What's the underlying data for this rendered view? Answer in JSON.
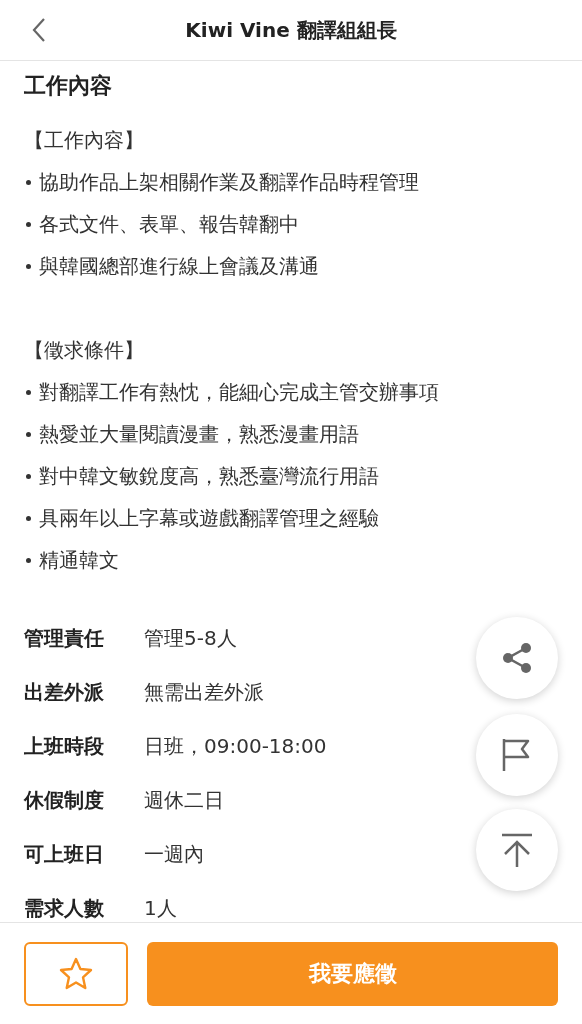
{
  "header": {
    "title": "Kiwi Vine 翻譯組組長"
  },
  "section_title": "工作內容",
  "groups": [
    {
      "heading": "【工作內容】",
      "items": [
        "協助作品上架相關作業及翻譯作品時程管理",
        "各式文件、表單、報告韓翻中",
        "與韓國總部進行線上會議及溝通"
      ]
    },
    {
      "heading": "【徵求條件】",
      "items": [
        "對翻譯工作有熱忱，能細心完成主管交辦事項",
        "熱愛並大量閱讀漫畫，熟悉漫畫用語",
        "對中韓文敏銳度高，熟悉臺灣流行用語",
        "具兩年以上字幕或遊戲翻譯管理之經驗",
        "精通韓文"
      ]
    }
  ],
  "details": [
    {
      "label": "管理責任",
      "value": "管理5-8人"
    },
    {
      "label": "出差外派",
      "value": "無需出差外派"
    },
    {
      "label": "上班時段",
      "value": "日班，09:00-18:00"
    },
    {
      "label": "休假制度",
      "value": "週休二日"
    },
    {
      "label": "可上班日",
      "value": "一週內"
    },
    {
      "label": "需求人數",
      "value": "1人"
    }
  ],
  "apply_button": "我要應徵"
}
